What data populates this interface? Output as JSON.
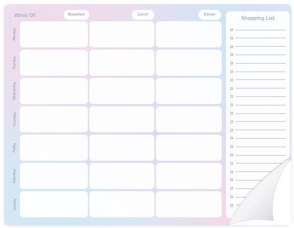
{
  "header": {
    "week_of": "Week Of:",
    "meals": [
      "Breakfast",
      "Lunch",
      "Dinner"
    ]
  },
  "days": [
    "Monday",
    "Tuesday",
    "Wednesday",
    "Thursday",
    "Friday",
    "Saturday",
    "Sunday"
  ],
  "shopping_list": {
    "title": "Shopping List",
    "item_count": 22
  },
  "colors": {
    "label_text": "#8c8ca4",
    "card": "#ffffff",
    "line": "#c9c9d8"
  }
}
